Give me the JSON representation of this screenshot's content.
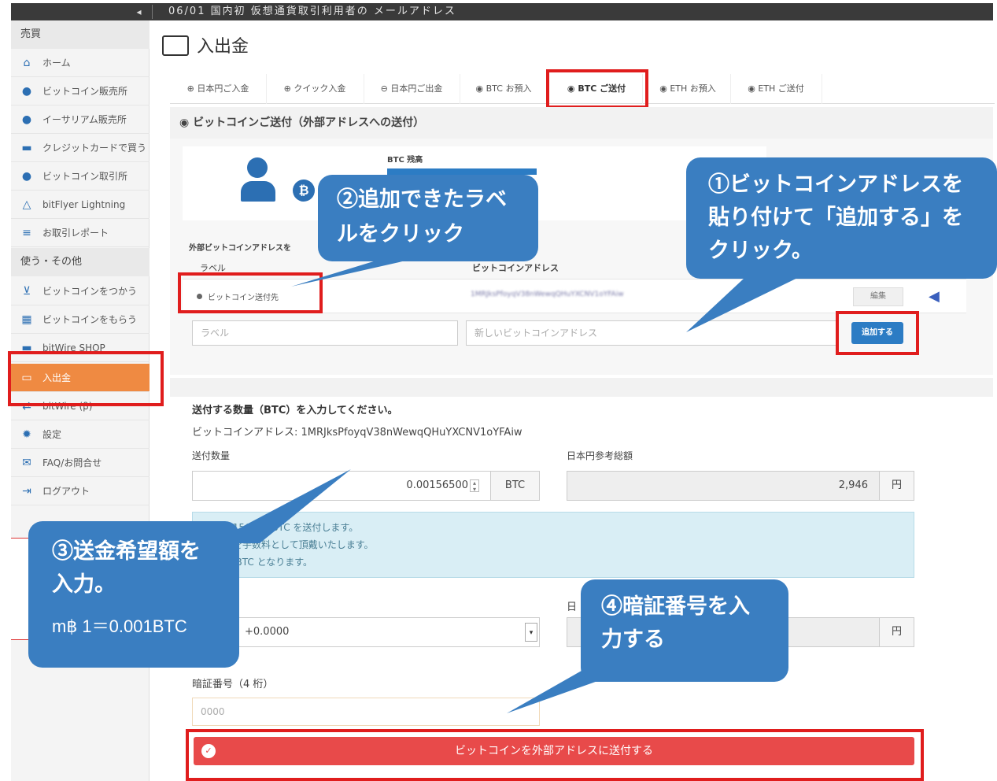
{
  "topbar": {
    "collapse_icon": "collapse-icon",
    "notice": "06/01 国内初 仮想通貨取引利用者の メールアドレス"
  },
  "sidebar": {
    "heading_trade": "売買",
    "items_trade": [
      {
        "label": "ホーム",
        "icon": "home-icon"
      },
      {
        "label": "ビットコイン販売所",
        "icon": "bitcoin-icon"
      },
      {
        "label": "イーサリアム販売所",
        "icon": "ethereum-icon"
      },
      {
        "label": "クレジットカードで買う",
        "icon": "credit-card-icon"
      },
      {
        "label": "ビットコイン取引所",
        "icon": "bitcoin-icon"
      },
      {
        "label": "bitFlyer Lightning",
        "icon": "lightning-icon"
      },
      {
        "label": "お取引レポート",
        "icon": "report-icon"
      }
    ],
    "heading_other": "使う・その他",
    "items_other": [
      {
        "label": "ビットコインをつかう",
        "icon": "cart-icon"
      },
      {
        "label": "ビットコインをもらう",
        "icon": "gift-icon"
      },
      {
        "label": "bitWire SHOP",
        "icon": "shop-icon"
      },
      {
        "label": "入出金",
        "icon": "wallet-icon"
      },
      {
        "label": "bitWire (β)",
        "icon": "transfer-icon"
      },
      {
        "label": "設定",
        "icon": "gear-icon"
      },
      {
        "label": "FAQ/お問合せ",
        "icon": "mail-icon"
      },
      {
        "label": "ログアウト",
        "icon": "logout-icon"
      }
    ]
  },
  "main": {
    "title": "入出金",
    "tabs": [
      "日本円ご入金",
      "クイック入金",
      "日本円ご出金",
      "BTC お預入",
      "BTC ご送付",
      "ETH お預入",
      "ETH ご送付"
    ],
    "section_title": "ビットコインご送付（外部アドレスへの送付）",
    "balance_label": "BTC 残高",
    "address_list": {
      "heading": "外部ビットコインアドレスを",
      "col_label": "ラベル",
      "col_address": "ビットコインアドレス",
      "row_label": "ビットコイン送付先",
      "row_address": "1MRJksPfoyqV38nWewqQHuYXCNV1oYFAiw",
      "edit_button": "編集",
      "label_placeholder": "ラベル",
      "address_placeholder": "新しいビットコインアドレス",
      "add_button": "追加する"
    },
    "send": {
      "heading": "送付する数量（BTC）を入力してください。",
      "address_line": "ビットコインアドレス: 1MRJksPfoyqV38nWewqQHuYXCNV1oYFAiw",
      "amount_label": "送付数量",
      "amount_value": "0.00156500",
      "amount_unit": "BTC",
      "jpy_label": "日本円参考総額",
      "jpy_value": "2,946",
      "jpy_unit": "円",
      "info_line1": "0.00156500 BTC を送付します。",
      "info_line2": "BTC を手数料として頂戴いたします。",
      "info_line3": "0.00 BTC となります。",
      "fee_value": "+0.0000",
      "fee_jpy_label": "日",
      "fee_jpy_unit": "円",
      "pin_label": "暗証番号（4 桁）",
      "pin_placeholder": "0000",
      "submit_button": "ビットコインを外部アドレスに送付する"
    }
  },
  "callouts": {
    "c1": "①ビットコインアドレスを貼り付けて「追加する」をクリック。",
    "c2": "②追加できたラベルをクリック",
    "c3_line1": "③送金希望額を入力。",
    "c3_line2": "m฿ 1＝0.001BTC",
    "c4": "④暗証番号を入力する"
  },
  "colors": {
    "accent_orange": "#ef8a42",
    "annotation_red": "#e01d1d",
    "callout_blue": "#3a7ec1",
    "button_blue": "#2c7cc4",
    "submit_red": "#e84a4a",
    "info_bg": "#d9eef5"
  }
}
